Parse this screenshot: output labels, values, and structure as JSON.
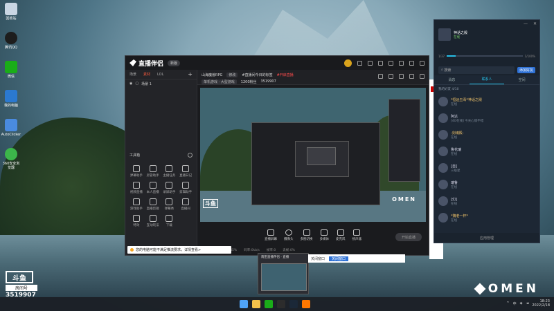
{
  "desktop": {
    "icons": [
      {
        "label": "回收站",
        "color": "#c9d6e3"
      },
      {
        "label": "腾讯QQ",
        "color": "#1d1d1d"
      },
      {
        "label": "微信",
        "color": "#1aad19"
      },
      {
        "label": "我的电脑",
        "color": "#2b79d0"
      },
      {
        "label": "AutoClicker",
        "color": "#4a8be0"
      },
      {
        "label": "360安全浏览器",
        "color": "#3cb64a"
      }
    ]
  },
  "watermark": {
    "douyu_logo": "斗鱼",
    "room_label": "房间号",
    "room_id": "3519907",
    "omen": "OMEN"
  },
  "app": {
    "name": "直播伴侣",
    "version_badge": "新版",
    "left_tabs": [
      "场景",
      "素材",
      "LOL"
    ],
    "active_left_tab": 1,
    "scene_name": "场景 1",
    "toolbox_label": "工具箱",
    "tools": [
      {
        "label": "弹幕助手"
      },
      {
        "label": "房管助手"
      },
      {
        "label": "主播任务"
      },
      {
        "label": "直播日记"
      },
      {
        "label": "视频直播"
      },
      {
        "label": "本人直播"
      },
      {
        "label": "录屏助手"
      },
      {
        "label": "剪辑助手"
      },
      {
        "label": "游戏助手"
      },
      {
        "label": "直播剪辑"
      },
      {
        "label": "弹幕秀"
      },
      {
        "label": "直播间"
      },
      {
        "label": "特效"
      },
      {
        "label": "互动玩法"
      },
      {
        "label": "下载"
      }
    ],
    "room_title": "山海魔兽RPG",
    "room_tag": "修改",
    "room_hint": "#直播间今日的标签",
    "room_red": "#开启直播",
    "category": "单机游戏 · 大型游戏",
    "fans_label": "1200粉丝",
    "room_number": "3519907",
    "bottom_buttons": [
      "直播屏幕",
      "摄像头",
      "多图切换",
      "多媒体",
      "麦克风",
      "扬声器"
    ],
    "start_live": "开始直播",
    "status_items": [
      "CPU:12%",
      "内存:45%",
      "码率:0kb/s",
      "帧率:0",
      "丢帧:0%"
    ],
    "notice": "您的电脑可能不满足推流要求，详情查看>"
  },
  "qq": {
    "username": "神话之殿",
    "status": "在线",
    "level_left": "1/37",
    "level_right": "1/100%",
    "level_fraction": 0.12,
    "search_placeholder": "搜索",
    "add_button": "添加好友",
    "panel_buttons": [
      "消息助手",
      "空间"
    ],
    "tabs": [
      "消息",
      "联系人",
      "空间"
    ],
    "active_tab": 1,
    "group_label": "我的好友 4/10",
    "contacts": [
      {
        "name": "*恒远五毒*神话之殿",
        "status": "在线",
        "vip": true
      },
      {
        "name": "阿达",
        "status": "[4G在线] 今天心情不错",
        "vip": false
      },
      {
        "name": "-剑魂殿-",
        "status": "在线",
        "vip": true
      },
      {
        "name": "鲁花瑞",
        "status": "在线",
        "vip": false
      },
      {
        "name": "[自]",
        "status": "三级星",
        "vip": false
      },
      {
        "name": "瑞鲁",
        "status": "在线",
        "vip": false
      },
      {
        "name": "[幻]",
        "status": "在线",
        "vip": false
      },
      {
        "name": "*魏老一杯*",
        "status": "在线",
        "vip": true
      }
    ],
    "bottom": "应用管理"
  },
  "popup": {
    "title": "南田直播伴侣 · 直播",
    "dialog_text": "关闭窗口",
    "dialog_button": "关闭窗口"
  },
  "taskbar": {
    "apps": [
      {
        "name": "start",
        "color": "#4fa3f7"
      },
      {
        "name": "explorer",
        "color": "#f3c24b"
      },
      {
        "name": "wechat",
        "color": "#1aad19"
      },
      {
        "name": "qq",
        "color": "#2c2c2c"
      },
      {
        "name": "steam",
        "color": "#1b2838"
      },
      {
        "name": "douyu",
        "color": "#ff7700"
      }
    ],
    "lang": "中",
    "time": "18:23",
    "date": "2022/2/18"
  }
}
